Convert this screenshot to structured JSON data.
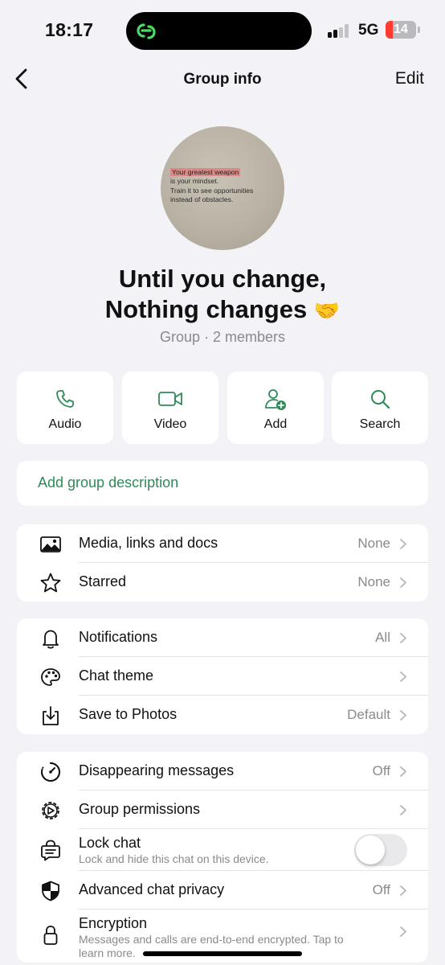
{
  "status_bar": {
    "time": "18:17",
    "network": "5G",
    "battery": "14",
    "battery_level": 0.14,
    "island_icon": "link-app-icon"
  },
  "nav": {
    "title": "Group info",
    "edit_label": "Edit",
    "back_icon": "chevron-left-icon"
  },
  "avatar": {
    "highlight": "Your greatest weapon",
    "lines": [
      "is your mindset.",
      "Train it to see opportunities",
      "instead of obstacles."
    ]
  },
  "group": {
    "name_line1": "Until you change,",
    "name_line2": "Nothing changes",
    "emoji": "🤝",
    "subtitle": "Group · 2 members"
  },
  "actions": [
    {
      "label": "Audio",
      "icon": "phone-icon"
    },
    {
      "label": "Video",
      "icon": "video-icon"
    },
    {
      "label": "Add",
      "icon": "add-person-icon"
    },
    {
      "label": "Search",
      "icon": "search-icon"
    }
  ],
  "description": {
    "label": "Add group description"
  },
  "media_section": [
    {
      "label": "Media, links and docs",
      "value": "None",
      "icon": "image-icon"
    },
    {
      "label": "Starred",
      "value": "None",
      "icon": "star-icon"
    }
  ],
  "settings_section": [
    {
      "label": "Notifications",
      "value": "All",
      "icon": "bell-icon"
    },
    {
      "label": "Chat theme",
      "value": "",
      "icon": "palette-icon"
    },
    {
      "label": "Save to Photos",
      "value": "Default",
      "icon": "download-icon"
    }
  ],
  "privacy_section": {
    "disappearing": {
      "label": "Disappearing messages",
      "value": "Off"
    },
    "permissions": {
      "label": "Group permissions"
    },
    "lock": {
      "label": "Lock chat",
      "sub": "Lock and hide this chat on this device.",
      "enabled": false
    },
    "advanced": {
      "label": "Advanced chat privacy",
      "value": "Off"
    },
    "encryption": {
      "label": "Encryption",
      "sub_line1": "Messages and calls are end-to-end encrypted. Tap to",
      "sub_line2": "learn more."
    }
  },
  "colors": {
    "accent_green": "#2e8b57",
    "background": "#f2f2f7",
    "battery_low": "#ff3b30"
  }
}
